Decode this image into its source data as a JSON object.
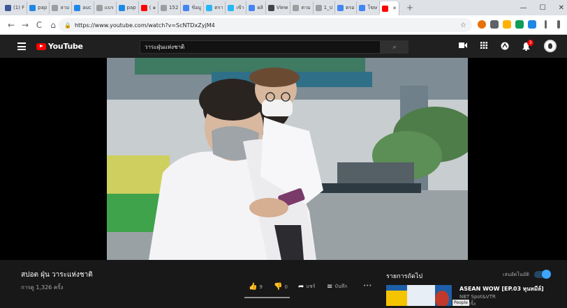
{
  "browser": {
    "tabs": [
      {
        "label": "(1) F",
        "color": "#3b5998"
      },
      {
        "label": "pap",
        "color": "#1e88e5"
      },
      {
        "label": "ลาม",
        "color": "#9e9e9e"
      },
      {
        "label": "auc",
        "color": "#1e88e5"
      },
      {
        "label": "แบร",
        "color": "#9e9e9e"
      },
      {
        "label": "pap",
        "color": "#1e88e5"
      },
      {
        "label": "( ๑",
        "color": "#ff0000"
      },
      {
        "label": "152",
        "color": "#9e9e9e"
      },
      {
        "label": "ข้อมู",
        "color": "#4285f4"
      },
      {
        "label": "ตรา",
        "color": "#29b6f6"
      },
      {
        "label": "เข้า",
        "color": "#29b6f6"
      },
      {
        "label": "ผลิ",
        "color": "#4285f4"
      },
      {
        "label": "View",
        "color": "#444444"
      },
      {
        "label": "ตาม",
        "color": "#9e9e9e"
      },
      {
        "label": "1_ป",
        "color": "#9e9e9e"
      },
      {
        "label": "ตรอ",
        "color": "#4285f4"
      },
      {
        "label": "โฆษ",
        "color": "#4285f4"
      },
      {
        "label": "",
        "color": "#ff0000"
      }
    ],
    "new_tab": "+",
    "window_controls": [
      "—",
      "☐",
      "✕"
    ],
    "url": "https://www.youtube.com/watch?v=ScNTDxZyjM4",
    "nav": {
      "back": "←",
      "forward": "→",
      "reload": "C",
      "home": "⌂"
    }
  },
  "youtube": {
    "logo_text": "YouTube",
    "search_value": "วาระฝุ่นแห่งชาติ",
    "search_icon": "⌕",
    "header_icons": [
      "video-camera-icon",
      "apps-grid-icon",
      "messages-icon",
      "bell-icon"
    ],
    "notification_count": "3"
  },
  "video": {
    "title": "สปอต ฝุ่น วาระแห่งชาติ",
    "views": "การดู 1,326 ครั้ง",
    "likes": "9",
    "dislikes": "0",
    "share_label": "แชร์",
    "save_label": "บันทึก",
    "more_label": "•••"
  },
  "sidebar": {
    "up_next_label": "รายการถัดไป",
    "autoplay_label": "เล่นอัตโนมัติ",
    "autoplay_on": true,
    "recommended": [
      {
        "title": "ASEAN WOW [EP.03 หุนหมีล์]",
        "channel": "NBT Spot&VTR",
        "views": "27 ครั้ง",
        "tooltip": "People"
      }
    ]
  },
  "colors": {
    "yt_red": "#ff0000",
    "yt_dark": "#202020",
    "page_bg": "#181818",
    "accent_blue": "#3ea6ff"
  }
}
